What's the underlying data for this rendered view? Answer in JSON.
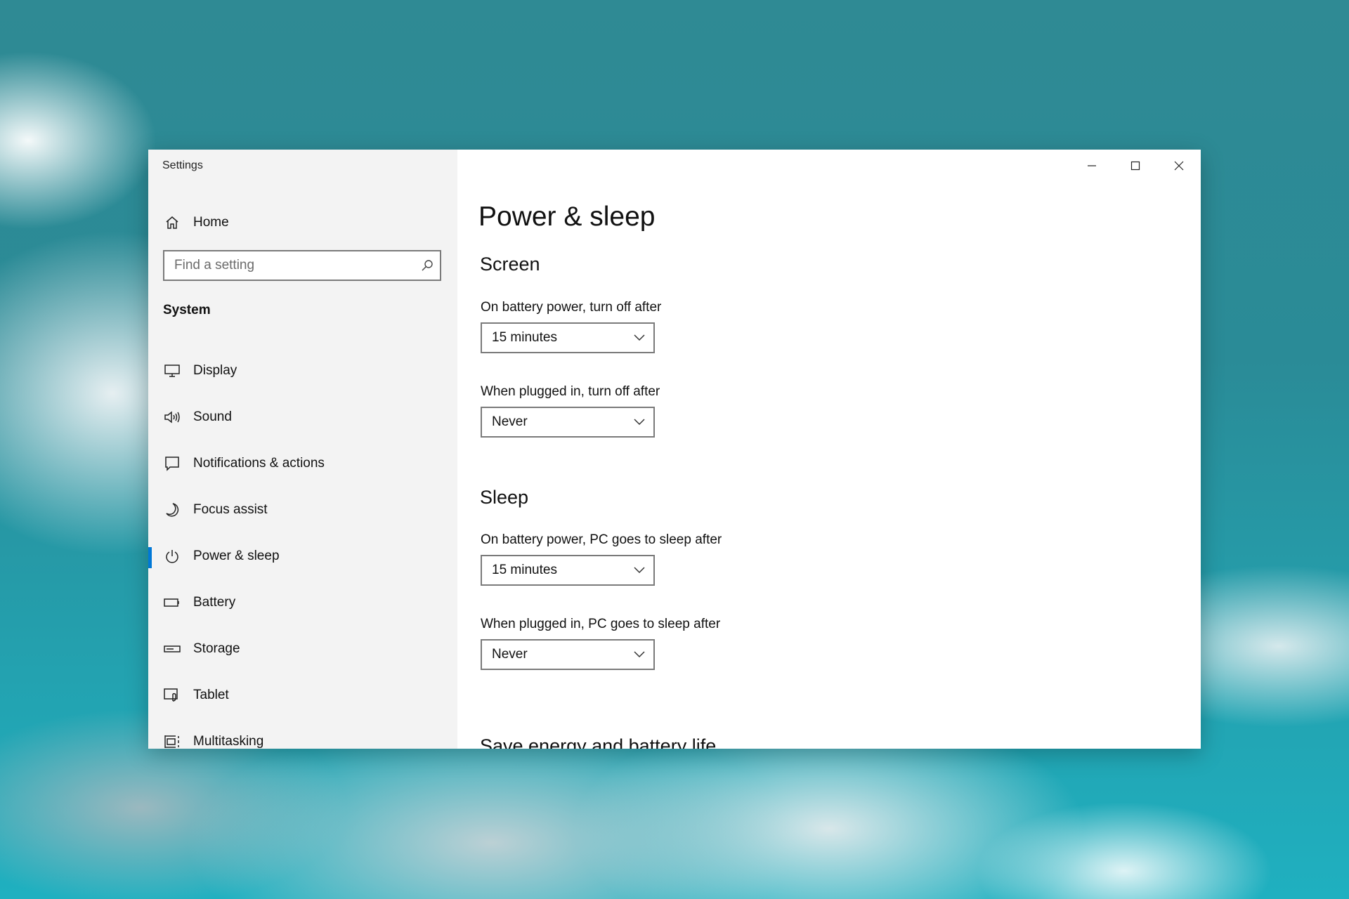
{
  "window": {
    "title": "Settings"
  },
  "sidebar": {
    "home_label": "Home",
    "search": {
      "placeholder": "Find a setting",
      "value": ""
    },
    "section_label": "System",
    "items": [
      {
        "label": "Display",
        "icon": "monitor-icon"
      },
      {
        "label": "Sound",
        "icon": "speaker-icon"
      },
      {
        "label": "Notifications & actions",
        "icon": "notification-icon"
      },
      {
        "label": "Focus assist",
        "icon": "moon-icon"
      },
      {
        "label": "Power & sleep",
        "icon": "power-icon",
        "active": true
      },
      {
        "label": "Battery",
        "icon": "battery-icon"
      },
      {
        "label": "Storage",
        "icon": "storage-icon"
      },
      {
        "label": "Tablet",
        "icon": "tablet-icon"
      },
      {
        "label": "Multitasking",
        "icon": "multitasking-icon"
      }
    ]
  },
  "main": {
    "page_title": "Power & sleep",
    "screen": {
      "title": "Screen",
      "battery_label": "On battery power, turn off after",
      "battery_value": "15 minutes",
      "plugged_label": "When plugged in, turn off after",
      "plugged_value": "Never"
    },
    "sleep": {
      "title": "Sleep",
      "battery_label": "On battery power, PC goes to sleep after",
      "battery_value": "15 minutes",
      "plugged_label": "When plugged in, PC goes to sleep after",
      "plugged_value": "Never"
    },
    "next_section_title": "Save energy and battery life"
  },
  "colors": {
    "accent": "#0078d7",
    "sidebar_bg": "#f3f3f3"
  }
}
